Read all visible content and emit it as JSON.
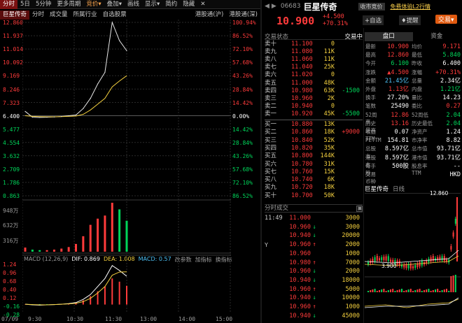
{
  "left_toolbar": {
    "items": [
      "分时",
      "5日",
      "5分钟",
      "更多周期",
      "竞价",
      "叠加",
      "画线",
      "显示",
      "简约",
      "隐藏"
    ],
    "active_index": 0
  },
  "sub_tabs": {
    "items": [
      "巨星传奇",
      "分时",
      "成交量",
      "所属行业",
      "自选股票"
    ],
    "active_index": 0,
    "right_items": [
      "港股通(沪)",
      "港股通(深)"
    ]
  },
  "price_axis": {
    "left": [
      "12.860",
      "11.937",
      "11.014",
      "10.092",
      "9.169",
      "8.246",
      "7.323",
      "6.400",
      "5.477",
      "4.554",
      "3.632",
      "2.709",
      "1.786",
      "0.863"
    ],
    "right": [
      "100.94%",
      "86.52%",
      "72.10%",
      "57.68%",
      "43.26%",
      "28.84%",
      "14.42%",
      "0.00%",
      "14.42%",
      "28.84%",
      "43.26%",
      "57.68%",
      "72.10%",
      "86.52%"
    ]
  },
  "volume_axis": [
    "948万",
    "632万",
    "316万"
  ],
  "macd_bar": {
    "label": "MACD (12,26,9)",
    "dif_label": "DIF: 0.869",
    "dea_label": "DEA: 1.008",
    "macd_label": "MACD: 0.57",
    "params_label": "改参数",
    "add_label": "加指标",
    "switch_label": "换指标"
  },
  "macd_axis": [
    "1.24",
    "0.96",
    "0.68",
    "0.40",
    "0.12",
    "-0.16",
    "-0.28"
  ],
  "time_axis": [
    "07/09",
    "9:30",
    "10:30",
    "11:30",
    "13:00",
    "14:00",
    "15:00"
  ],
  "chart_data": {
    "type": "line",
    "title": "巨星传奇 分时",
    "prev_close": 6.4,
    "ylim": [
      0.863,
      12.86
    ],
    "x": [
      "9:30",
      "9:45",
      "10:00",
      "10:15",
      "10:30",
      "10:45",
      "11:00",
      "11:10",
      "11:20",
      "11:25",
      "11:30",
      "11:35",
      "11:40",
      "11:45",
      "11:49"
    ],
    "series": [
      {
        "name": "价格",
        "values": [
          6.7,
          6.3,
          6.28,
          6.3,
          6.32,
          6.35,
          6.4,
          6.45,
          6.9,
          7.6,
          8.6,
          9.4,
          12.86,
          11.6,
          10.9
        ]
      },
      {
        "name": "均价",
        "values": [
          6.4,
          6.36,
          6.34,
          6.33,
          6.33,
          6.34,
          6.36,
          6.38,
          6.5,
          6.8,
          7.2,
          7.6,
          8.4,
          8.8,
          9.17
        ]
      }
    ],
    "volume": [
      80,
      40,
      30,
      30,
      40,
      60,
      90,
      150,
      300,
      520,
      640,
      700,
      948,
      820,
      600
    ],
    "macd": [
      0.0,
      -0.02,
      -0.03,
      -0.02,
      -0.01,
      0.0,
      0.02,
      0.05,
      0.12,
      0.25,
      0.4,
      0.55,
      0.8,
      0.7,
      0.57
    ],
    "dif": [
      0.0,
      -0.02,
      -0.03,
      -0.02,
      -0.01,
      0.0,
      0.02,
      0.05,
      0.15,
      0.3,
      0.55,
      0.8,
      1.2,
      1.05,
      0.869
    ],
    "dea": [
      0.0,
      -0.01,
      -0.02,
      -0.02,
      -0.01,
      0.0,
      0.01,
      0.03,
      0.08,
      0.18,
      0.35,
      0.55,
      0.9,
      1.0,
      1.008
    ]
  },
  "rt_header": {
    "code": "06683",
    "name": "巨星传奇",
    "delayed_label": "收市竞价",
    "free_label": "免费体验L2行情"
  },
  "quote": {
    "price": "10.900",
    "change": "+4.500",
    "pct": "+70.31%",
    "self_select_label": "自选",
    "alert_label": "提醒",
    "trade_label": "交易"
  },
  "orderbook_header": {
    "title": "交易状态",
    "status": "交易中"
  },
  "sells": [
    {
      "label": "卖十",
      "price": "11.100",
      "vol": "0",
      "chg": ""
    },
    {
      "label": "卖九",
      "price": "11.080",
      "vol": "11K",
      "chg": ""
    },
    {
      "label": "卖八",
      "price": "11.060",
      "vol": "11K",
      "chg": ""
    },
    {
      "label": "卖七",
      "price": "11.040",
      "vol": "25K",
      "chg": ""
    },
    {
      "label": "卖六",
      "price": "11.020",
      "vol": "0",
      "chg": ""
    },
    {
      "label": "卖五",
      "price": "11.000",
      "vol": "48K",
      "chg": ""
    },
    {
      "label": "卖四",
      "price": "10.980",
      "vol": "63K",
      "chg": "-1500"
    },
    {
      "label": "卖三",
      "price": "10.960",
      "vol": "2K",
      "chg": ""
    },
    {
      "label": "卖二",
      "price": "10.940",
      "vol": "0",
      "chg": ""
    },
    {
      "label": "卖一",
      "price": "10.920",
      "vol": "45K",
      "chg": "-5500"
    }
  ],
  "buys": [
    {
      "label": "买一",
      "price": "10.880",
      "vol": "13K",
      "chg": ""
    },
    {
      "label": "买二",
      "price": "10.860",
      "vol": "18K",
      "chg": "+9000"
    },
    {
      "label": "买三",
      "price": "10.840",
      "vol": "52K",
      "chg": ""
    },
    {
      "label": "买四",
      "price": "10.820",
      "vol": "35K",
      "chg": ""
    },
    {
      "label": "买五",
      "price": "10.800",
      "vol": "144K",
      "chg": ""
    },
    {
      "label": "买六",
      "price": "10.780",
      "vol": "31K",
      "chg": ""
    },
    {
      "label": "买七",
      "price": "10.760",
      "vol": "15K",
      "chg": ""
    },
    {
      "label": "买八",
      "price": "10.740",
      "vol": "6K",
      "chg": ""
    },
    {
      "label": "买九",
      "price": "10.720",
      "vol": "18K",
      "chg": ""
    },
    {
      "label": "买十",
      "price": "10.700",
      "vol": "50K",
      "chg": ""
    }
  ],
  "trades_header": "分时成交",
  "trades": [
    {
      "time": "11:49",
      "price": "11.000",
      "arrow": "",
      "vol": "3000"
    },
    {
      "time": "",
      "price": "10.960",
      "arrow": "↓",
      "vol": "3000"
    },
    {
      "time": "",
      "price": "10.940",
      "arrow": "↓",
      "vol": "20000"
    },
    {
      "time": "",
      "price": "10.960",
      "arrow": "↑",
      "vol": "2000"
    },
    {
      "time": "",
      "price": "10.960",
      "arrow": "",
      "vol": "1000"
    },
    {
      "time": "",
      "price": "10.980",
      "arrow": "↑",
      "vol": "7000"
    },
    {
      "time": "",
      "price": "10.960",
      "arrow": "↓",
      "vol": "2000"
    },
    {
      "time": "",
      "price": "10.940",
      "arrow": "↓",
      "vol": "18000"
    },
    {
      "time": "",
      "price": "10.960",
      "arrow": "↑",
      "vol": "5000"
    },
    {
      "time": "",
      "price": "10.940",
      "arrow": "↓",
      "vol": "10000"
    },
    {
      "time": "",
      "price": "10.960",
      "arrow": "↑",
      "vol": "1000"
    },
    {
      "time": "",
      "price": "10.940",
      "arrow": "↓",
      "vol": "45000"
    }
  ],
  "panel_tabs": [
    "盘口",
    "资金"
  ],
  "stats": [
    {
      "k1": "最新",
      "v1": "10.900",
      "c1": "red",
      "k2": "均价",
      "v2": "9.171",
      "c2": "red"
    },
    {
      "k1": "最高",
      "v1": "12.860",
      "c1": "red",
      "k2": "最低",
      "v2": "5.840",
      "c2": "green"
    },
    {
      "k1": "今开",
      "v1": "6.100",
      "c1": "green",
      "k2": "昨收",
      "v2": "6.400",
      "c2": "white"
    },
    {
      "k1": "涨跌",
      "v1": "▲4.500",
      "c1": "red",
      "k2": "涨幅",
      "v2": "+70.31%",
      "c2": "red"
    },
    {
      "k1": "金额",
      "v1": "21.45亿",
      "c1": "cyan",
      "k2": "总量",
      "v2": "2.34亿",
      "c2": "white"
    },
    {
      "k1": "外盘",
      "v1": "1.13亿",
      "c1": "red",
      "k2": "内盘",
      "v2": "1.21亿",
      "c2": "green"
    },
    {
      "k1": "换手",
      "v1": "27.20%",
      "c1": "white",
      "k2": "量比",
      "v2": "14.23",
      "c2": "white"
    },
    {
      "k1": "笔数",
      "v1": "25490",
      "c1": "white",
      "k2": "委比",
      "v2": "0.27",
      "c2": "red"
    },
    {
      "k1": "52周高",
      "v1": "12.86",
      "c1": "red",
      "k2": "52周低",
      "v2": "2.04",
      "c2": "green"
    },
    {
      "k1": "历史最高",
      "v1": "13.16",
      "c1": "red",
      "k2": "历史最低",
      "v2": "2.04",
      "c2": "green"
    },
    {
      "k1": "收益TTM",
      "v1": "0.07",
      "c1": "white",
      "k2": "净资产",
      "v2": "1.24",
      "c2": "white"
    },
    {
      "k1": "PETTM",
      "v1": "154.81",
      "c1": "white",
      "k2": "市净率",
      "v2": "8.82",
      "c2": "white"
    },
    {
      "k1": "总股本",
      "v1": "8.597亿",
      "c1": "white",
      "k2": "总市值",
      "v2": "93.71亿",
      "c2": "white"
    },
    {
      "k1": "港股本",
      "v1": "8.597亿",
      "c1": "white",
      "k2": "港市值",
      "v2": "93.71亿",
      "c2": "white"
    },
    {
      "k1": "每手股",
      "v1": "500股",
      "c1": "white",
      "k2": "股息率TTM",
      "v2": "--",
      "c2": "white"
    },
    {
      "k1": "交易币种",
      "v1": "",
      "c1": "white",
      "k2": "",
      "v2": "HKD",
      "c2": "white"
    }
  ],
  "mini_chart": {
    "title": "巨星传奇",
    "period": "日线",
    "high_label": "12.860",
    "low_label": "3.900"
  }
}
